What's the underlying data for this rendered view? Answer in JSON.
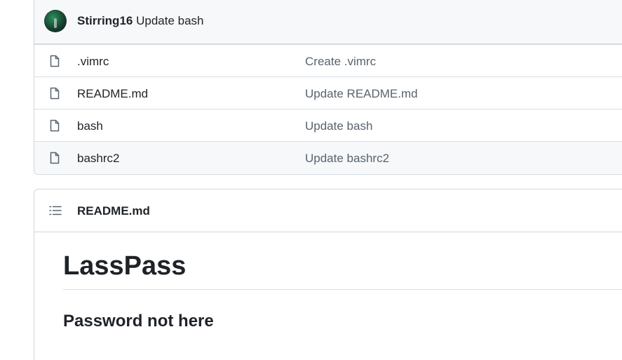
{
  "commit": {
    "author": "Stirring16",
    "message": "Update bash"
  },
  "files": [
    {
      "name": ".vimrc",
      "last_commit": "Create .vimrc",
      "icon": "file-icon"
    },
    {
      "name": "README.md",
      "last_commit": "Update README.md",
      "icon": "file-icon"
    },
    {
      "name": "bash",
      "last_commit": "Update bash",
      "icon": "file-icon"
    },
    {
      "name": "bashrc2",
      "last_commit": "Update bashrc2",
      "icon": "file-icon"
    }
  ],
  "readme": {
    "title": "README.md",
    "icon": "list-icon",
    "heading": "LassPass",
    "subheading": "Password not here"
  },
  "colors": {
    "border": "#d0d7de",
    "header_bg": "#f6f8fa",
    "muted_text": "#59636e",
    "text": "#1f2328"
  }
}
